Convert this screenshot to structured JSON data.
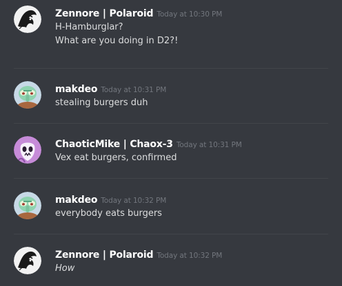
{
  "messages": [
    {
      "author": "Zennore | Polaroid",
      "timestamp": "Today at 10:30 PM",
      "avatar_icon": "polaroid-avatar-icon",
      "lines": [
        "H-Hamburglar?",
        "What are you doing in D2?!"
      ]
    },
    {
      "author": "makdeo",
      "timestamp": "Today at 10:31 PM",
      "avatar_icon": "squidward-avatar-icon",
      "lines": [
        "stealing burgers duh"
      ]
    },
    {
      "author": "ChaoticMike | Chaox-3",
      "timestamp": "Today at 10:31 PM",
      "avatar_icon": "ghost-avatar-icon",
      "lines": [
        "Vex eat burgers, confirmed"
      ]
    },
    {
      "author": "makdeo",
      "timestamp": "Today at 10:32 PM",
      "avatar_icon": "squidward-avatar-icon",
      "lines": [
        "everybody eats burgers"
      ]
    },
    {
      "author": "Zennore | Polaroid",
      "timestamp": "Today at 10:32 PM",
      "avatar_icon": "polaroid-avatar-icon",
      "lines": [
        "How"
      ]
    }
  ],
  "colors": {
    "background": "#36393f",
    "username": "#ffffff",
    "timestamp": "#72767d",
    "message_text": "#dcddde",
    "divider": "#42454a"
  }
}
